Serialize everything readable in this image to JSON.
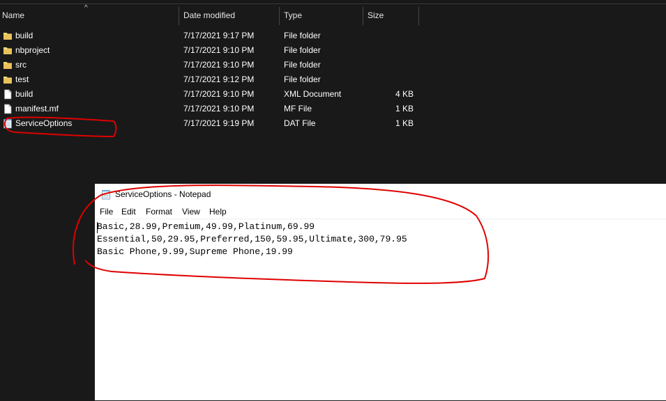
{
  "explorer": {
    "columns": {
      "name": "Name",
      "date": "Date modified",
      "type": "Type",
      "size": "Size"
    },
    "sort_indicator": "^",
    "rows": [
      {
        "name": "build",
        "date": "7/17/2021 9:17 PM",
        "type": "File folder",
        "size": "",
        "icon": "folder-icon"
      },
      {
        "name": "nbproject",
        "date": "7/17/2021 9:10 PM",
        "type": "File folder",
        "size": "",
        "icon": "folder-icon"
      },
      {
        "name": "src",
        "date": "7/17/2021 9:10 PM",
        "type": "File folder",
        "size": "",
        "icon": "folder-icon"
      },
      {
        "name": "test",
        "date": "7/17/2021 9:12 PM",
        "type": "File folder",
        "size": "",
        "icon": "folder-icon"
      },
      {
        "name": "build",
        "date": "7/17/2021 9:10 PM",
        "type": "XML Document",
        "size": "4 KB",
        "icon": "document-icon"
      },
      {
        "name": "manifest.mf",
        "date": "7/17/2021 9:10 PM",
        "type": "MF File",
        "size": "1 KB",
        "icon": "document-icon"
      },
      {
        "name": "ServiceOptions",
        "date": "7/17/2021 9:19 PM",
        "type": "DAT File",
        "size": "1 KB",
        "icon": "notepad-file-icon"
      }
    ]
  },
  "notepad": {
    "title": "ServiceOptions - Notepad",
    "menu": [
      "File",
      "Edit",
      "Format",
      "View",
      "Help"
    ],
    "lines": [
      "Basic,28.99,Premium,49.99,Platinum,69.99",
      "Essential,50,29.95,Preferred,150,59.95,Ultimate,300,79.95",
      "Basic Phone,9.99,Supreme Phone,19.99"
    ]
  },
  "colors": {
    "explorer_background": "#191919",
    "folder": "#f8d775",
    "annotation": "#e00000"
  }
}
